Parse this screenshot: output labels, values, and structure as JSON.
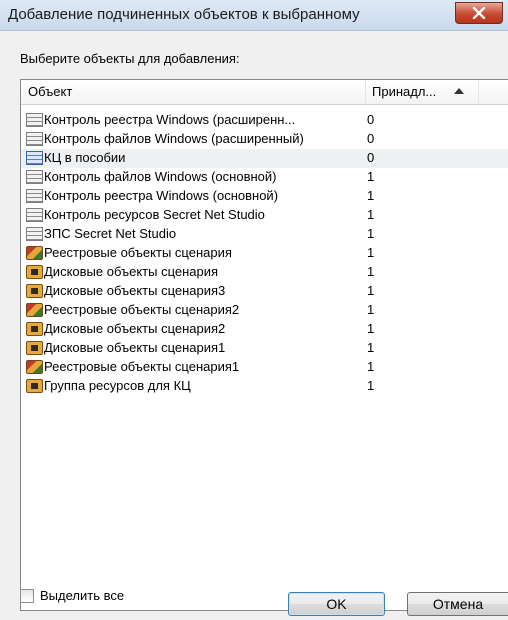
{
  "window": {
    "title": "Добавление подчиненных объектов к выбранному",
    "close_icon": "close-icon"
  },
  "prompt": "Выберите объекты для добавления:",
  "table": {
    "columns": [
      "Объект",
      "Принадл..."
    ],
    "sorted_column": "Принадл...",
    "sort_direction": "ascending",
    "rows": [
      {
        "name": "Контроль реестра Windows (расширенн...",
        "value": "0",
        "icon": "list-icon"
      },
      {
        "name": "Контроль файлов Windows (расширенный)",
        "value": "0",
        "icon": "list-icon"
      },
      {
        "name": "КЦ в пособии",
        "value": "0",
        "icon": "list-icon",
        "selected": true
      },
      {
        "name": "Контроль файлов Windows (основной)",
        "value": "1",
        "icon": "list-icon"
      },
      {
        "name": "Контроль реестра Windows (основной)",
        "value": "1",
        "icon": "list-icon"
      },
      {
        "name": "Контроль ресурсов Secret Net Studio",
        "value": "1",
        "icon": "list-icon"
      },
      {
        "name": "ЗПС Secret Net Studio",
        "value": "1",
        "icon": "list-icon"
      },
      {
        "name": "Реестровые объекты сценария",
        "value": "1",
        "icon": "registry-icon"
      },
      {
        "name": "Дисковые объекты сценария",
        "value": "1",
        "icon": "disk-icon"
      },
      {
        "name": "Дисковые объекты сценария3",
        "value": "1",
        "icon": "disk-icon"
      },
      {
        "name": "Реестровые объекты сценария2",
        "value": "1",
        "icon": "registry-icon"
      },
      {
        "name": "Дисковые объекты сценария2",
        "value": "1",
        "icon": "disk-icon"
      },
      {
        "name": "Дисковые объекты сценария1",
        "value": "1",
        "icon": "disk-icon"
      },
      {
        "name": "Реестровые объекты сценария1",
        "value": "1",
        "icon": "registry-icon"
      },
      {
        "name": "Группа ресурсов для КЦ",
        "value": "1",
        "icon": "disk-icon"
      }
    ]
  },
  "footer": {
    "select_all_label": "Выделить все",
    "select_all_checked": false,
    "ok_label": "OK",
    "cancel_label": "Отмена"
  }
}
